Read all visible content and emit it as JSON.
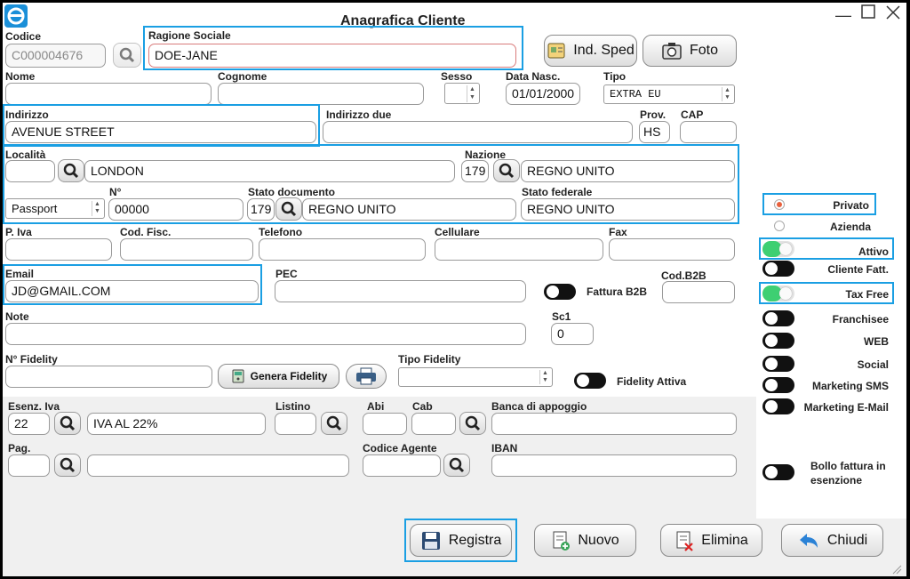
{
  "window": {
    "title": "Anagrafica Cliente"
  },
  "header": {
    "codice_label": "Codice",
    "codice_value": "C000004676",
    "ragione_label": "Ragione Sociale",
    "ragione_value": "DOE-JANE",
    "ind_sped_label": "Ind. Sped",
    "foto_label": "Foto"
  },
  "anag": {
    "nome_label": "Nome",
    "nome_value": "",
    "cognome_label": "Cognome",
    "cognome_value": "",
    "sesso_label": "Sesso",
    "sesso_value": "",
    "data_label": "Data Nasc.",
    "data_value": "01/01/2000",
    "tipo_label": "Tipo",
    "tipo_value": "EXTRA EU"
  },
  "address": {
    "indirizzo_label": "Indirizzo",
    "indirizzo_value": "AVENUE STREET",
    "indirizzo2_label": "Indirizzo due",
    "indirizzo2_value": "",
    "prov_label": "Prov.",
    "prov_value": "HS",
    "cap_label": "CAP",
    "cap_value": "",
    "localita_label": "Località",
    "localita_code": "",
    "localita_value": "LONDON",
    "nazione_label": "Nazione",
    "nazione_code": "179",
    "nazione_value": "REGNO UNITO",
    "doc_type": "Passport",
    "num_label": "N°",
    "num_value": "00000",
    "stato_doc_label": "Stato documento",
    "stato_doc_code": "179",
    "stato_doc_value": "REGNO UNITO",
    "stato_fed_label": "Stato federale",
    "stato_fed_value": "REGNO UNITO"
  },
  "contacts": {
    "piva_label": "P. Iva",
    "codfisc_label": "Cod. Fisc.",
    "telefono_label": "Telefono",
    "cellulare_label": "Cellulare",
    "fax_label": "Fax",
    "email_label": "Email",
    "email_value": "JD@GMAIL.COM",
    "pec_label": "PEC",
    "fattura_b2b_label": "Fattura B2B",
    "codb2b_label": "Cod.B2B",
    "note_label": "Note",
    "sc1_label": "Sc1",
    "sc1_value": "0",
    "fidelity_label": "N° Fidelity",
    "genera_fidelity_label": "Genera Fidelity",
    "tipo_fidelity_label": "Tipo Fidelity",
    "fidelity_attiva_label": "Fidelity Attiva"
  },
  "banking": {
    "esenz_label": "Esenz. Iva",
    "esenz_code": "22",
    "esenz_value": "IVA AL 22%",
    "listino_label": "Listino",
    "abi_label": "Abi",
    "cab_label": "Cab",
    "banca_label": "Banca di appoggio",
    "pag_label": "Pag.",
    "agente_label": "Codice Agente",
    "iban_label": "IBAN"
  },
  "right_panel": {
    "privato_label": "Privato",
    "azienda_label": "Azienda",
    "attivo_label": "Attivo",
    "cliente_fatt_label": "Cliente Fatt.",
    "tax_free_label": "Tax Free",
    "franchisee_label": "Franchisee",
    "web_label": "WEB",
    "social_label": "Social",
    "marketing_sms_label": "Marketing SMS",
    "marketing_email_label": "Marketing E-Mail",
    "bollo_label_1": "Bollo fattura in",
    "bollo_label_2": "esenzione"
  },
  "footer": {
    "registra_label": "Registra",
    "nuovo_label": "Nuovo",
    "elimina_label": "Elimina",
    "chiudi_label": "Chiudi"
  },
  "colors": {
    "highlight": "#1a9fe3",
    "toggle_on": "#3ecf72",
    "radio_selected": "#e8603c"
  }
}
